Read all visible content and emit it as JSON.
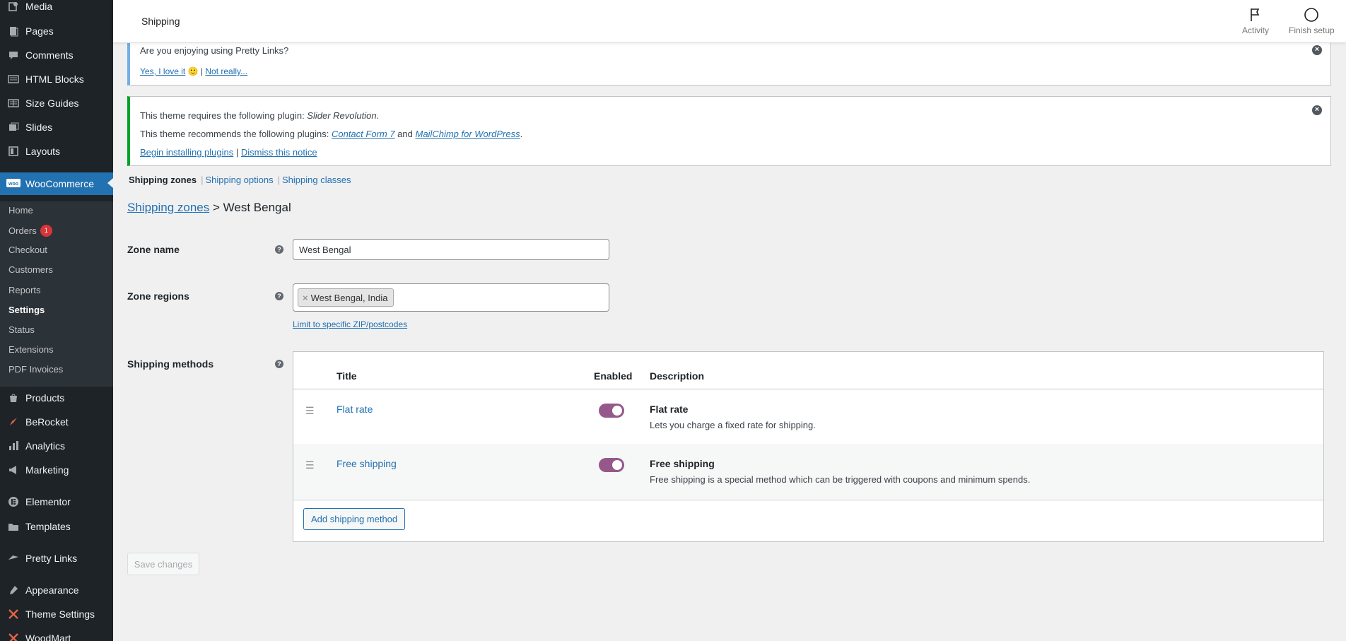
{
  "sidebar": {
    "items": [
      {
        "label": "Media",
        "icon": "media-icon"
      },
      {
        "label": "Pages",
        "icon": "pages-icon"
      },
      {
        "label": "Comments",
        "icon": "comments-icon"
      },
      {
        "label": "HTML Blocks",
        "icon": "html-blocks-icon"
      },
      {
        "label": "Size Guides",
        "icon": "size-guides-icon"
      },
      {
        "label": "Slides",
        "icon": "slides-icon"
      },
      {
        "label": "Layouts",
        "icon": "layouts-icon"
      },
      {
        "label": "WooCommerce",
        "icon": "woocommerce-icon",
        "active": true
      },
      {
        "label": "Products",
        "icon": "products-icon"
      },
      {
        "label": "BeRocket",
        "icon": "berocket-icon"
      },
      {
        "label": "Analytics",
        "icon": "analytics-icon"
      },
      {
        "label": "Marketing",
        "icon": "marketing-icon"
      },
      {
        "label": "Elementor",
        "icon": "elementor-icon"
      },
      {
        "label": "Templates",
        "icon": "templates-icon"
      },
      {
        "label": "Pretty Links",
        "icon": "pretty-links-icon"
      },
      {
        "label": "Appearance",
        "icon": "appearance-icon"
      },
      {
        "label": "Theme Settings",
        "icon": "theme-settings-icon"
      },
      {
        "label": "WoodMart",
        "icon": "woodmart-icon"
      }
    ],
    "woo_submenu": [
      {
        "label": "Home"
      },
      {
        "label": "Orders",
        "badge": "1"
      },
      {
        "label": "Checkout"
      },
      {
        "label": "Customers"
      },
      {
        "label": "Reports"
      },
      {
        "label": "Settings",
        "current": true
      },
      {
        "label": "Status"
      },
      {
        "label": "Extensions"
      },
      {
        "label": "PDF Invoices"
      }
    ]
  },
  "topbar": {
    "title": "Shipping",
    "activity_label": "Activity",
    "finish_setup_label": "Finish setup"
  },
  "notices": {
    "pretty_links": {
      "question": "Are you enjoying using Pretty Links?",
      "yes_link": "Yes, I love it",
      "emoji": "🙂",
      "separator": "|",
      "no_link": "Not really..."
    },
    "theme_plugins": {
      "line1_prefix": "This theme requires the following plugin: ",
      "line1_plugin": "Slider Revolution",
      "line1_suffix": ".",
      "line2_prefix": "This theme recommends the following plugins: ",
      "line2_plugin1": "Contact Form 7",
      "line2_and": " and ",
      "line2_plugin2": "MailChimp for WordPress",
      "line2_suffix": ".",
      "begin_link": "Begin installing plugins",
      "separator": "|",
      "dismiss_link": "Dismiss this notice"
    }
  },
  "subtabs": {
    "zones": "Shipping zones",
    "options": "Shipping options",
    "classes": "Shipping classes",
    "separator": "|"
  },
  "heading": {
    "link": "Shipping zones",
    "arrow": ">",
    "zone": "West Bengal"
  },
  "form": {
    "zone_name_label": "Zone name",
    "zone_name_value": "West Bengal",
    "zone_regions_label": "Zone regions",
    "region_chip": "West Bengal, India",
    "chip_remove": "×",
    "zip_link": "Limit to specific ZIP/postcodes",
    "shipping_methods_label": "Shipping methods",
    "help_glyph": "?"
  },
  "methods_table": {
    "headers": {
      "title": "Title",
      "enabled": "Enabled",
      "description": "Description"
    },
    "rows": [
      {
        "title": "Flat rate",
        "enabled": true,
        "desc_title": "Flat rate",
        "desc": "Lets you charge a fixed rate for shipping."
      },
      {
        "title": "Free shipping",
        "enabled": true,
        "desc_title": "Free shipping",
        "desc": "Free shipping is a special method which can be triggered with coupons and minimum spends."
      }
    ],
    "add_button": "Add shipping method"
  },
  "save_button": "Save changes",
  "colors": {
    "sidebar_bg": "#1d2327",
    "accent": "#2271b1",
    "toggle_on": "#96588a",
    "badge": "#d63638"
  }
}
